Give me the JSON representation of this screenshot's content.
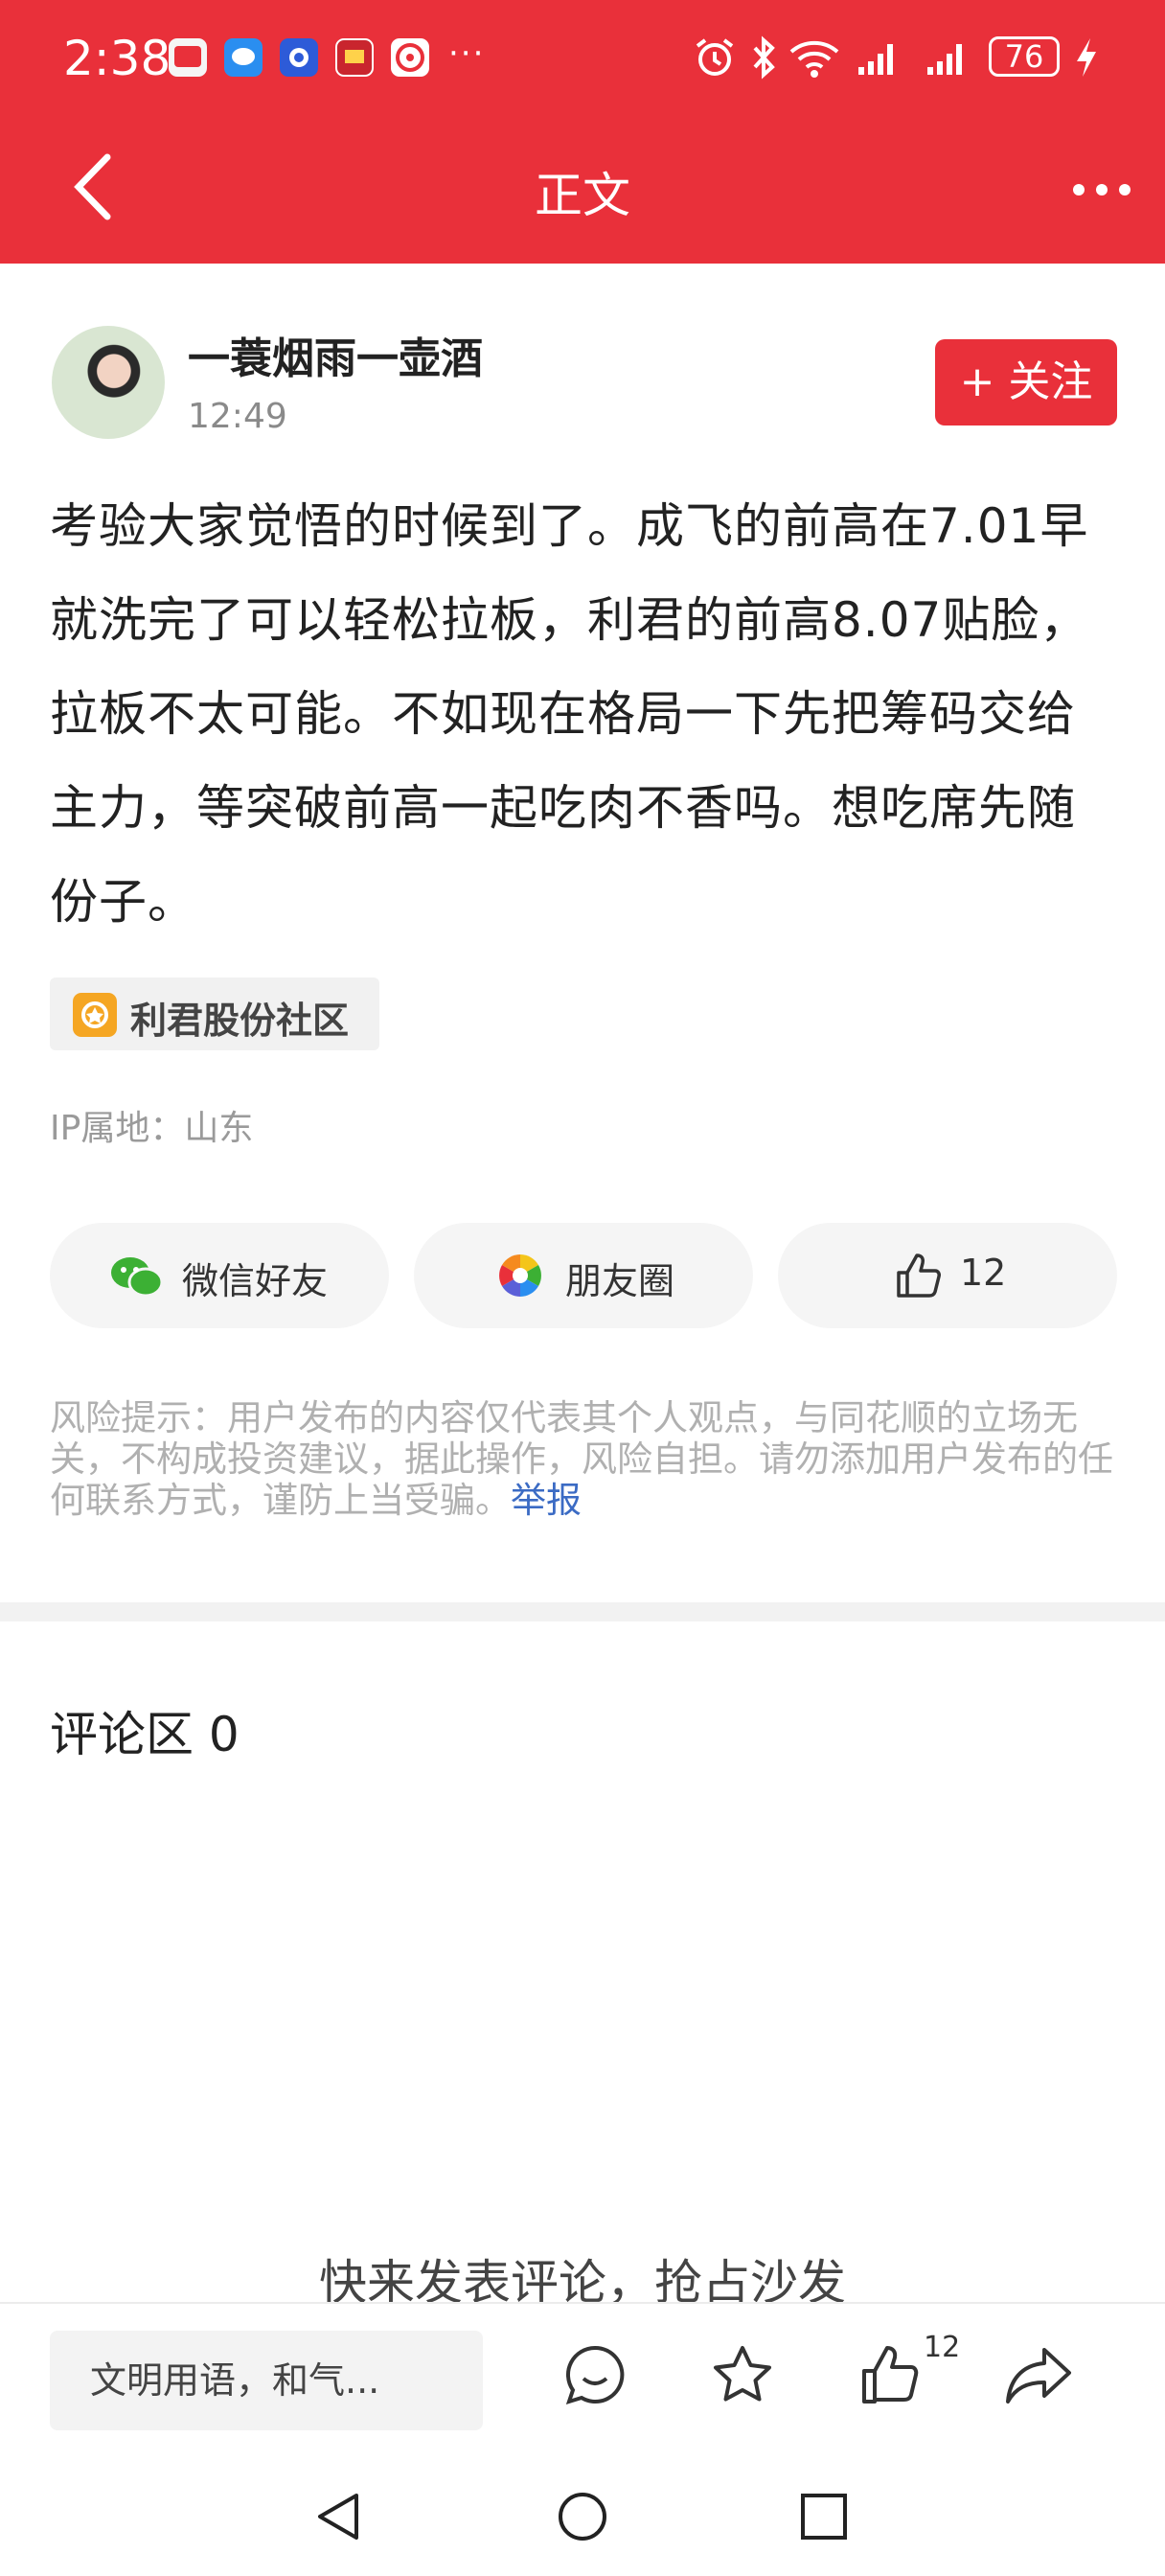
{
  "status_bar": {
    "time": "2:38",
    "more": "···",
    "battery": "76"
  },
  "header": {
    "title": "正文"
  },
  "post": {
    "author": "一蓑烟雨一壶酒",
    "time": "12:49",
    "follow_label": "+ 关注",
    "content": "考验大家觉悟的时候到了。成飞的前高在7.01早就洗完了可以轻松拉板，利君的前高8.07贴脸，拉板不太可能。不如现在格局一下先把筹码交给主力，等突破前高一起吃肉不香吗。想吃席先随份子。",
    "tag": "利君股份社区",
    "ip": "IP属地：山东"
  },
  "share": {
    "wechat": "微信好友",
    "moments": "朋友圈",
    "likes": "12"
  },
  "risk": {
    "text": "风险提示：用户发布的内容仅代表其个人观点，与同花顺的立场无关，不构成投资建议，据此操作，风险自担。请勿添加用户发布的任何联系方式，谨防上当受骗。",
    "report": "举报"
  },
  "comments": {
    "header": "评论区 0",
    "empty": "快来发表评论，抢占沙发"
  },
  "bottom_bar": {
    "placeholder": "文明用语，和气...",
    "like_count": "12"
  },
  "colors": {
    "brand": "#e9303a",
    "link": "#3b6bc4"
  }
}
